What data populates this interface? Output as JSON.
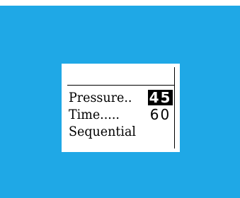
{
  "screen": {
    "background_color": "#1fa8e6",
    "display_color": "#ffffff"
  },
  "lcd": {
    "rows": [
      {
        "label": "Pressure..",
        "value": "45",
        "selected": true
      },
      {
        "label": "Time.....",
        "value": "60",
        "selected": false
      },
      {
        "label": "Sequential"
      }
    ]
  }
}
